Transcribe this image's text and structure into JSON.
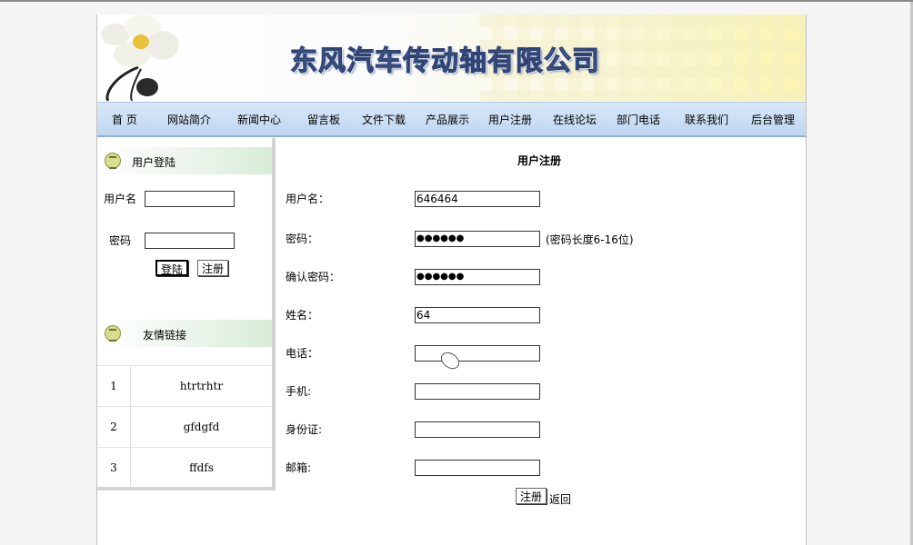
{
  "header": {
    "company_name": "东风汽车传动轴有限公司"
  },
  "nav": {
    "items": [
      {
        "label": "首 页",
        "icon": ""
      },
      {
        "label": "网站简介"
      },
      {
        "label": "新闻中心"
      },
      {
        "label": "留言板"
      },
      {
        "label": "文件下载"
      },
      {
        "label": "产品展示"
      },
      {
        "label": "用户注册"
      },
      {
        "label": "在线论坛"
      },
      {
        "label": "部门电话"
      },
      {
        "label": "联系我们"
      },
      {
        "label": "后台管理"
      }
    ]
  },
  "sidebar": {
    "login": {
      "title": "用户登陆",
      "username_label": "用户名",
      "password_label": "密码",
      "login_button": "登陆",
      "register_button": "注册"
    },
    "links": {
      "title": "友情链接",
      "items": [
        {
          "num": "1",
          "name": "htrtrhtr"
        },
        {
          "num": "2",
          "name": "gfdgfd"
        },
        {
          "num": "3",
          "name": "ffdfs"
        }
      ]
    }
  },
  "form": {
    "title": "用户注册",
    "username": {
      "label": "用户名：",
      "value": "646464"
    },
    "password": {
      "label": "密码：",
      "value": "●●●●●●",
      "hint": "(密码长度6-16位)"
    },
    "confirm": {
      "label": "确认密码：",
      "value": "●●●●●●"
    },
    "name": {
      "label": "姓名：",
      "value": "64"
    },
    "phone": {
      "label": "电话：",
      "value": ""
    },
    "mobile": {
      "label": "手机:",
      "value": ""
    },
    "idcard": {
      "label": "身份证:",
      "value": ""
    },
    "email": {
      "label": "邮箱:",
      "value": ""
    },
    "submit_button": "注册",
    "return_link": "返回"
  },
  "colors": {
    "nav_bg": "#c9dcf2",
    "title_text": "#6e86b4"
  }
}
